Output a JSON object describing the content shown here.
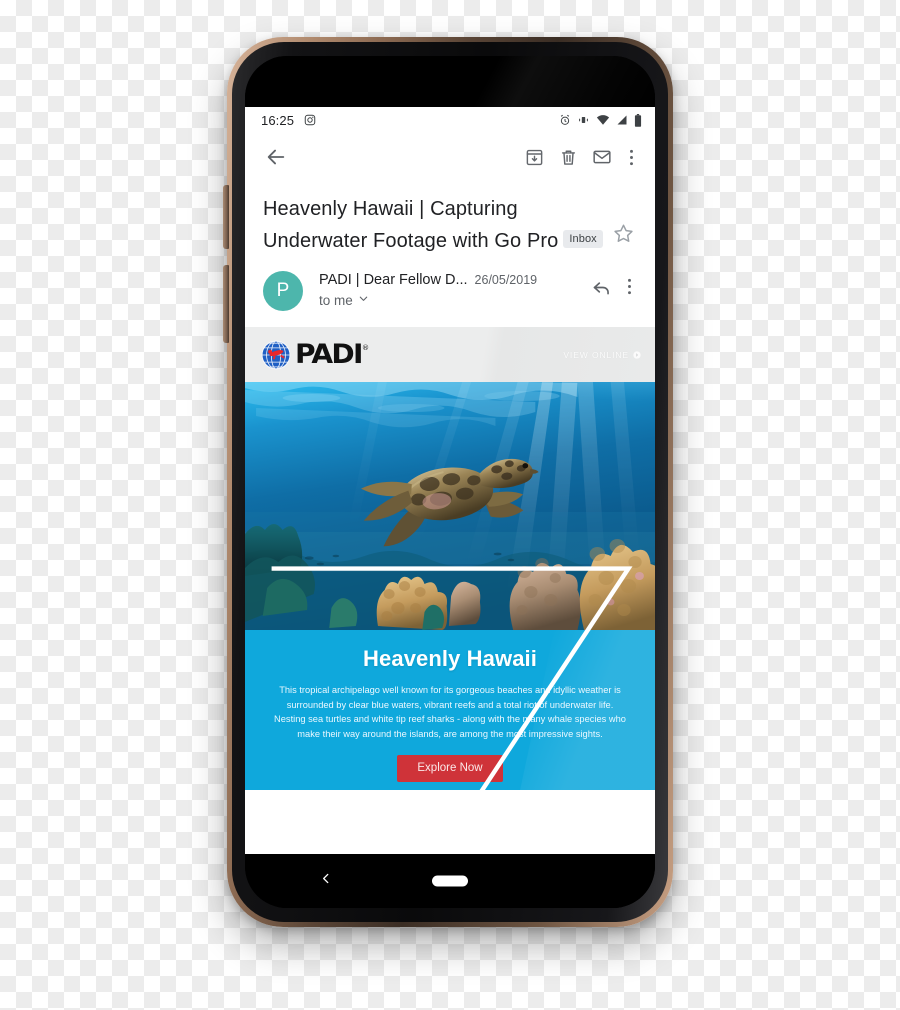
{
  "device": {
    "name": "android-smartphone",
    "frame_color": "#8c6a52"
  },
  "status_bar": {
    "time": "16:25",
    "icons": [
      "instagram-icon",
      "alarm-icon",
      "vibrate-icon",
      "wifi-icon",
      "signal-icon",
      "battery-icon"
    ]
  },
  "toolbar": {
    "back_icon": "back-arrow-icon",
    "archive_icon": "archive-icon",
    "delete_icon": "trash-icon",
    "mark_unread_icon": "envelope-icon",
    "more_icon": "more-vertical-icon"
  },
  "email": {
    "subject": "Heavenly Hawaii | Capturing Underwater Footage with Go Pro",
    "label": "Inbox",
    "starred": false,
    "avatar_initial": "P",
    "avatar_color": "#4db6ac",
    "sender": "PADI | Dear Fellow D...",
    "date": "26/05/2019",
    "recipient": "to me",
    "reply_icon": "reply-arrow-icon",
    "overflow_icon": "more-vertical-icon"
  },
  "newsletter": {
    "brand": "PADI",
    "brand_tm": "®",
    "view_online": "VIEW ONLINE",
    "view_online_icon": "circle-arrow-icon",
    "hero_alt": "sea-turtle-coral-reef-underwater",
    "headline": "Heavenly Hawaii",
    "body": "This tropical archipelago well known for its gorgeous beaches and idyllic weather is surrounded by clear blue waters, vibrant reefs and a total riot of underwater life. Nesting sea turtles and white tip reef sharks - along with the many whale species who make their way around the islands, are among the most impressive sights.",
    "cta_label": "Explore Now",
    "cta_color": "#cf3339",
    "panel_color": "#0fa8dc"
  },
  "nav_bar": {
    "back_icon": "chevron-left-icon",
    "home_indicator": "home-pill-indicator"
  }
}
